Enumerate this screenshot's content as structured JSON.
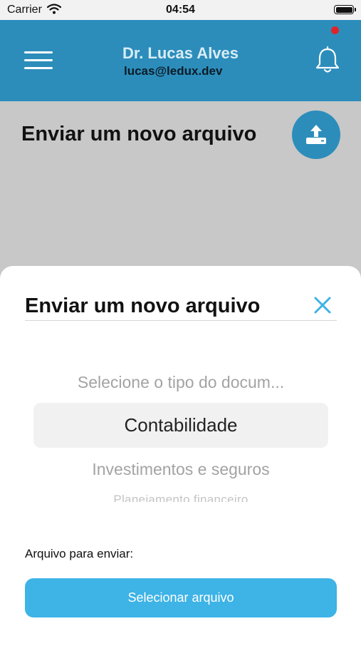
{
  "status_bar": {
    "carrier": "Carrier",
    "time": "04:54",
    "wifi_icon": "wifi-icon",
    "battery_icon": "battery-icon",
    "battery_level": 1.0
  },
  "header": {
    "menu_icon": "menu-icon",
    "user_name": "Dr. Lucas Alves",
    "user_email": "lucas@ledux.dev",
    "bell_icon": "bell-icon",
    "notification_dot_color": "#e0232a",
    "background_color": "#2c8dbb"
  },
  "page": {
    "title": "Enviar um novo arquivo",
    "upload_icon": "upload-icon"
  },
  "sheet": {
    "title": "Enviar um novo arquivo",
    "close_icon": "close-icon",
    "picker": {
      "options": [
        "Selecione o tipo do docum...",
        "Contabilidade",
        "Investimentos e seguros",
        "Planejamento financeiro"
      ],
      "selected": "Contabilidade"
    },
    "file_label": "Arquivo para enviar:",
    "select_file_button": "Selecionar arquivo",
    "accent_color": "#3db3e6"
  }
}
